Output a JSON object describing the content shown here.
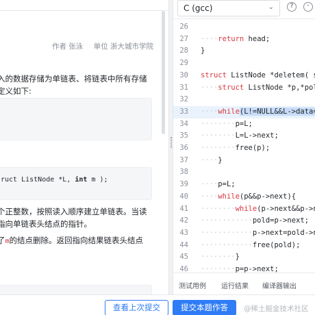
{
  "problem": {
    "author_label": "作者 张泳",
    "org_label": "单位 浙大城市学院",
    "p1_line1": "入的数据存储为单链表、将链表中所有存储",
    "p1_line2": "定义如下:",
    "func_sig_prefix": "ruct ListNode *L, ",
    "func_sig_kw": "int",
    "func_sig_suffix": " m );",
    "p2_line1": "个正整数，按照读入顺序建立单链表。当读",
    "p2_line2": "指向单链表头结点的指针。",
    "p3_prefix": "了",
    "p3_var": "m",
    "p3_suffix": "的结点删除。返回指向结果链表头结点"
  },
  "editor": {
    "language": "C (gcc)",
    "lines": [
      {
        "num": "26",
        "code": ""
      },
      {
        "num": "27",
        "dots": "····",
        "kw": "return",
        "rest": " head;"
      },
      {
        "num": "28",
        "code": "}"
      },
      {
        "num": "29",
        "code": ""
      },
      {
        "num": "30",
        "kw": "struct",
        "rest": " ListNode *deletem( s"
      },
      {
        "num": "31",
        "dots": "····",
        "kw": "struct",
        "rest": " ListNode *p,*pol"
      },
      {
        "num": "32",
        "code": ""
      },
      {
        "num": "33",
        "dots": "····",
        "kw": "while",
        "rest": "(L!=NULL&&L->data="
      },
      {
        "num": "34",
        "dots": "········",
        "code": "p=L;"
      },
      {
        "num": "35",
        "dots": "········",
        "code": "L=L->next;"
      },
      {
        "num": "36",
        "dots": "········",
        "code": "free(p);"
      },
      {
        "num": "37",
        "dots": "····",
        "code": "}"
      },
      {
        "num": "38",
        "code": ""
      },
      {
        "num": "39",
        "dots": "····",
        "code": "p=L;"
      },
      {
        "num": "40",
        "dots": "····",
        "kw": "while",
        "rest": "(p&&p->next){"
      },
      {
        "num": "41",
        "dots": "········",
        "kw": "while",
        "rest": "(p->next&&p->n"
      },
      {
        "num": "42",
        "dots": "············",
        "code": "pold=p->next;"
      },
      {
        "num": "43",
        "dots": "············",
        "code": "p->next=pold->n"
      },
      {
        "num": "44",
        "dots": "············",
        "code": "free(pold);"
      },
      {
        "num": "45",
        "dots": "········",
        "code": "}"
      },
      {
        "num": "46",
        "dots": "········",
        "code": "p=p->next;"
      }
    ]
  },
  "tabs": {
    "test_cases": "测试用例",
    "run_results": "运行结果",
    "compiler_output": "编译器输出"
  },
  "footer": {
    "view_last": "查看上次提交",
    "submit": "提交本题作答",
    "watermark": "@稀土掘金技术社区"
  },
  "colors": {
    "accent": "#2f7cf6",
    "keyword": "#d9363e"
  }
}
